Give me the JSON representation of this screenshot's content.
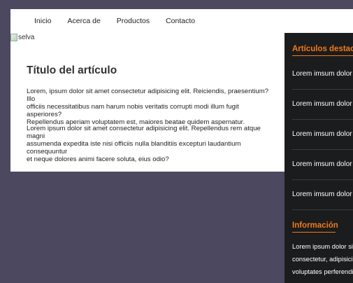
{
  "nav": {
    "items": [
      "Inicio",
      "Acerca de",
      "Productos",
      "Contacto"
    ]
  },
  "content": {
    "image_alt": "selva",
    "title": "Título del artículo",
    "paragraph1_lines": [
      "Lorem, ipsum dolor sit amet consectetur adipisicing elit. Reiciendis, praesentium? Illo",
      "officiis necessitatibus nam harum nobis veritatis corrupti modi illum fugit asperiores?",
      "Repellendus aperiam voluptatem est, maiores beatae quidem aspernatur."
    ],
    "paragraph2_lines": [
      "Lorem ipsum dolor sit amet consectetur adipisicing elit. Repellendus rem atque magni",
      "assumenda expedita iste nisi officiis nulla blanditiis excepturi laudantium consequuntur",
      "et neque dolores animi facere soluta, eius odio?"
    ]
  },
  "sidebar": {
    "featured_heading": "Artículos destacados",
    "featured_items": [
      "Lorem imsum dolor sit",
      "Lorem imsum dolor sit",
      "Lorem imsum dolor sit",
      "Lorem imsum dolor sit",
      "Lorem imsum dolor sit"
    ],
    "info_heading": "Información",
    "info_lines": [
      "Lorem ipsum dolor sit",
      "consectetur, adipisicing",
      "voluptates perferendis"
    ]
  },
  "colors": {
    "background": "#4b4860",
    "sidebar": "#1b1c1d",
    "accent": "#f07a1a"
  }
}
